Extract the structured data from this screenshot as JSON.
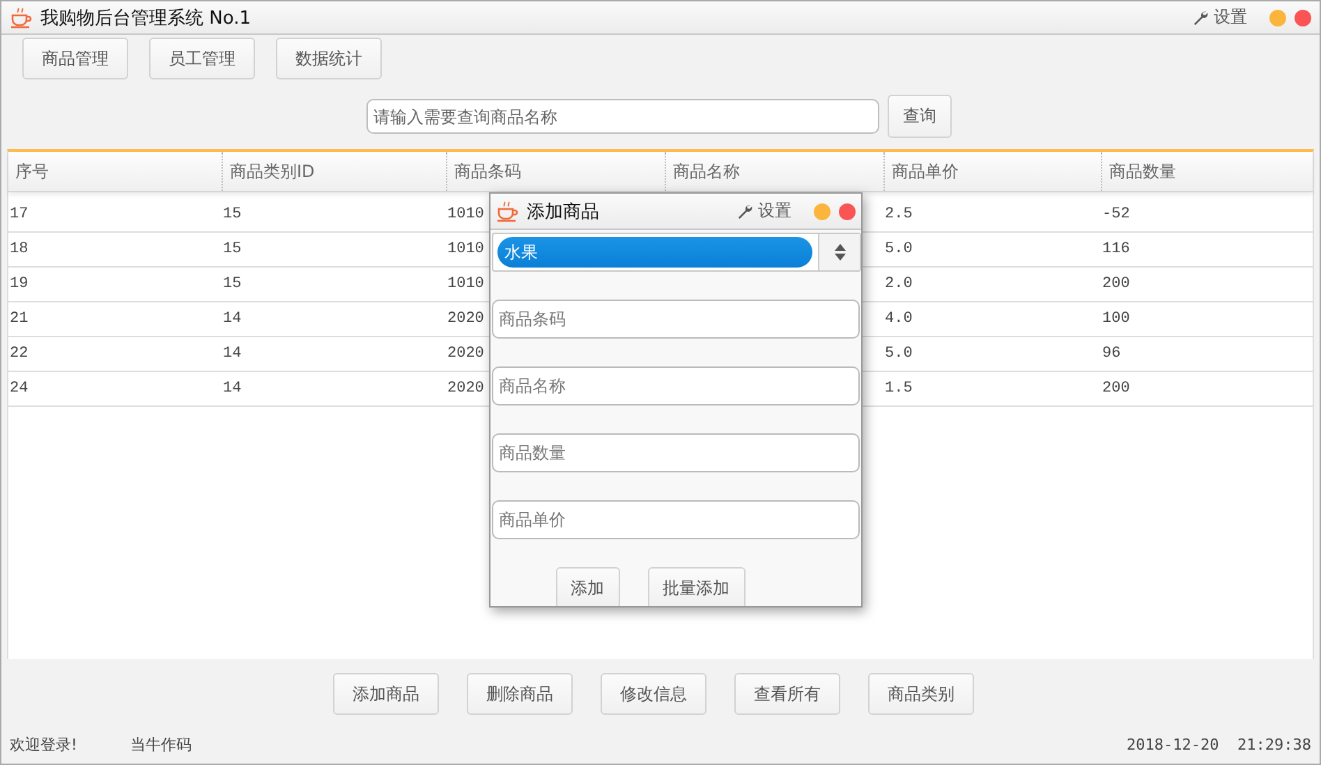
{
  "window": {
    "title": "我购物后台管理系统 No.1",
    "settings": "设置"
  },
  "nav_buttons": [
    "商品管理",
    "员工管理",
    "数据统计"
  ],
  "search": {
    "placeholder": "请输入需要查询商品名称",
    "button": "查询"
  },
  "table": {
    "columns": [
      "序号",
      "商品类别ID",
      "商品条码",
      "商品名称",
      "商品单价",
      "商品数量"
    ],
    "rows": [
      {
        "cells": [
          "17",
          "15",
          "1010",
          "",
          "2.5",
          "-52"
        ]
      },
      {
        "cells": [
          "18",
          "15",
          "1010",
          "",
          "5.0",
          "116"
        ]
      },
      {
        "cells": [
          "19",
          "15",
          "1010",
          "",
          "2.0",
          "200"
        ]
      },
      {
        "cells": [
          "21",
          "14",
          "2020",
          "",
          "4.0",
          "100"
        ]
      },
      {
        "cells": [
          "22",
          "14",
          "2020",
          "",
          "5.0",
          "96"
        ]
      },
      {
        "cells": [
          "24",
          "14",
          "2020",
          "",
          "1.5",
          "200"
        ]
      }
    ]
  },
  "action_buttons": [
    "添加商品",
    "删除商品",
    "修改信息",
    "查看所有",
    "商品类别"
  ],
  "status_bar": {
    "welcome": "欢迎登录!",
    "author": "当牛作码",
    "datetime": "2018-12-20  21:29:38"
  },
  "dialog": {
    "title": "添加商品",
    "settings": "设置",
    "category": "水果",
    "fields": [
      {
        "placeholder": "商品条码"
      },
      {
        "placeholder": "商品名称"
      },
      {
        "placeholder": "商品数量"
      },
      {
        "placeholder": "商品单价"
      }
    ],
    "buttons": [
      "添加",
      "批量添加"
    ]
  }
}
